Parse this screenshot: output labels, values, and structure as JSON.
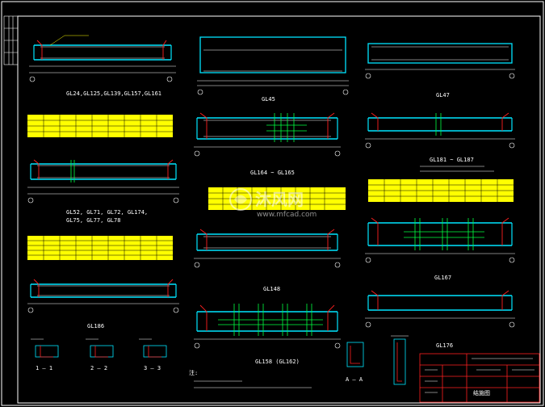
{
  "colors": {
    "background": "#000000",
    "frame": "#ffffff",
    "beam": "#00e5ff",
    "rebar_red": "#ff2020",
    "rebar_green": "#00ff40",
    "table_fill": "#ffff00",
    "title_block": "#ff2020"
  },
  "beams": {
    "gl24_group": {
      "title": "GL24,GL125,GL139,GL157,GL161"
    },
    "gl45": {
      "title": "GL45"
    },
    "gl47": {
      "title": "GL47"
    },
    "gl52_group": {
      "title_line1": "GL52, GL71, GL72, GL174,",
      "title_line2": "GL75, GL77, GL78"
    },
    "gl164_group": {
      "title": "GL164 ~ GL165"
    },
    "gl181_group": {
      "title": "GL181 ~ GL187"
    },
    "gl186": {
      "title": "GL186"
    },
    "gl148": {
      "title": "GL148"
    },
    "gl167": {
      "title": "GL167"
    },
    "gl158_group": {
      "title": "GL158 (GL162)"
    },
    "gl176": {
      "title": "GL176"
    }
  },
  "sections": {
    "s1": "1 — 1",
    "s2": "2 — 2",
    "s3": "3 — 3",
    "sa": "A — A"
  },
  "notes": {
    "heading": "注:"
  },
  "title_block": {
    "stamp": "结施图"
  },
  "watermark": {
    "brand": "沐风网",
    "url": "www.mfcad.com"
  }
}
